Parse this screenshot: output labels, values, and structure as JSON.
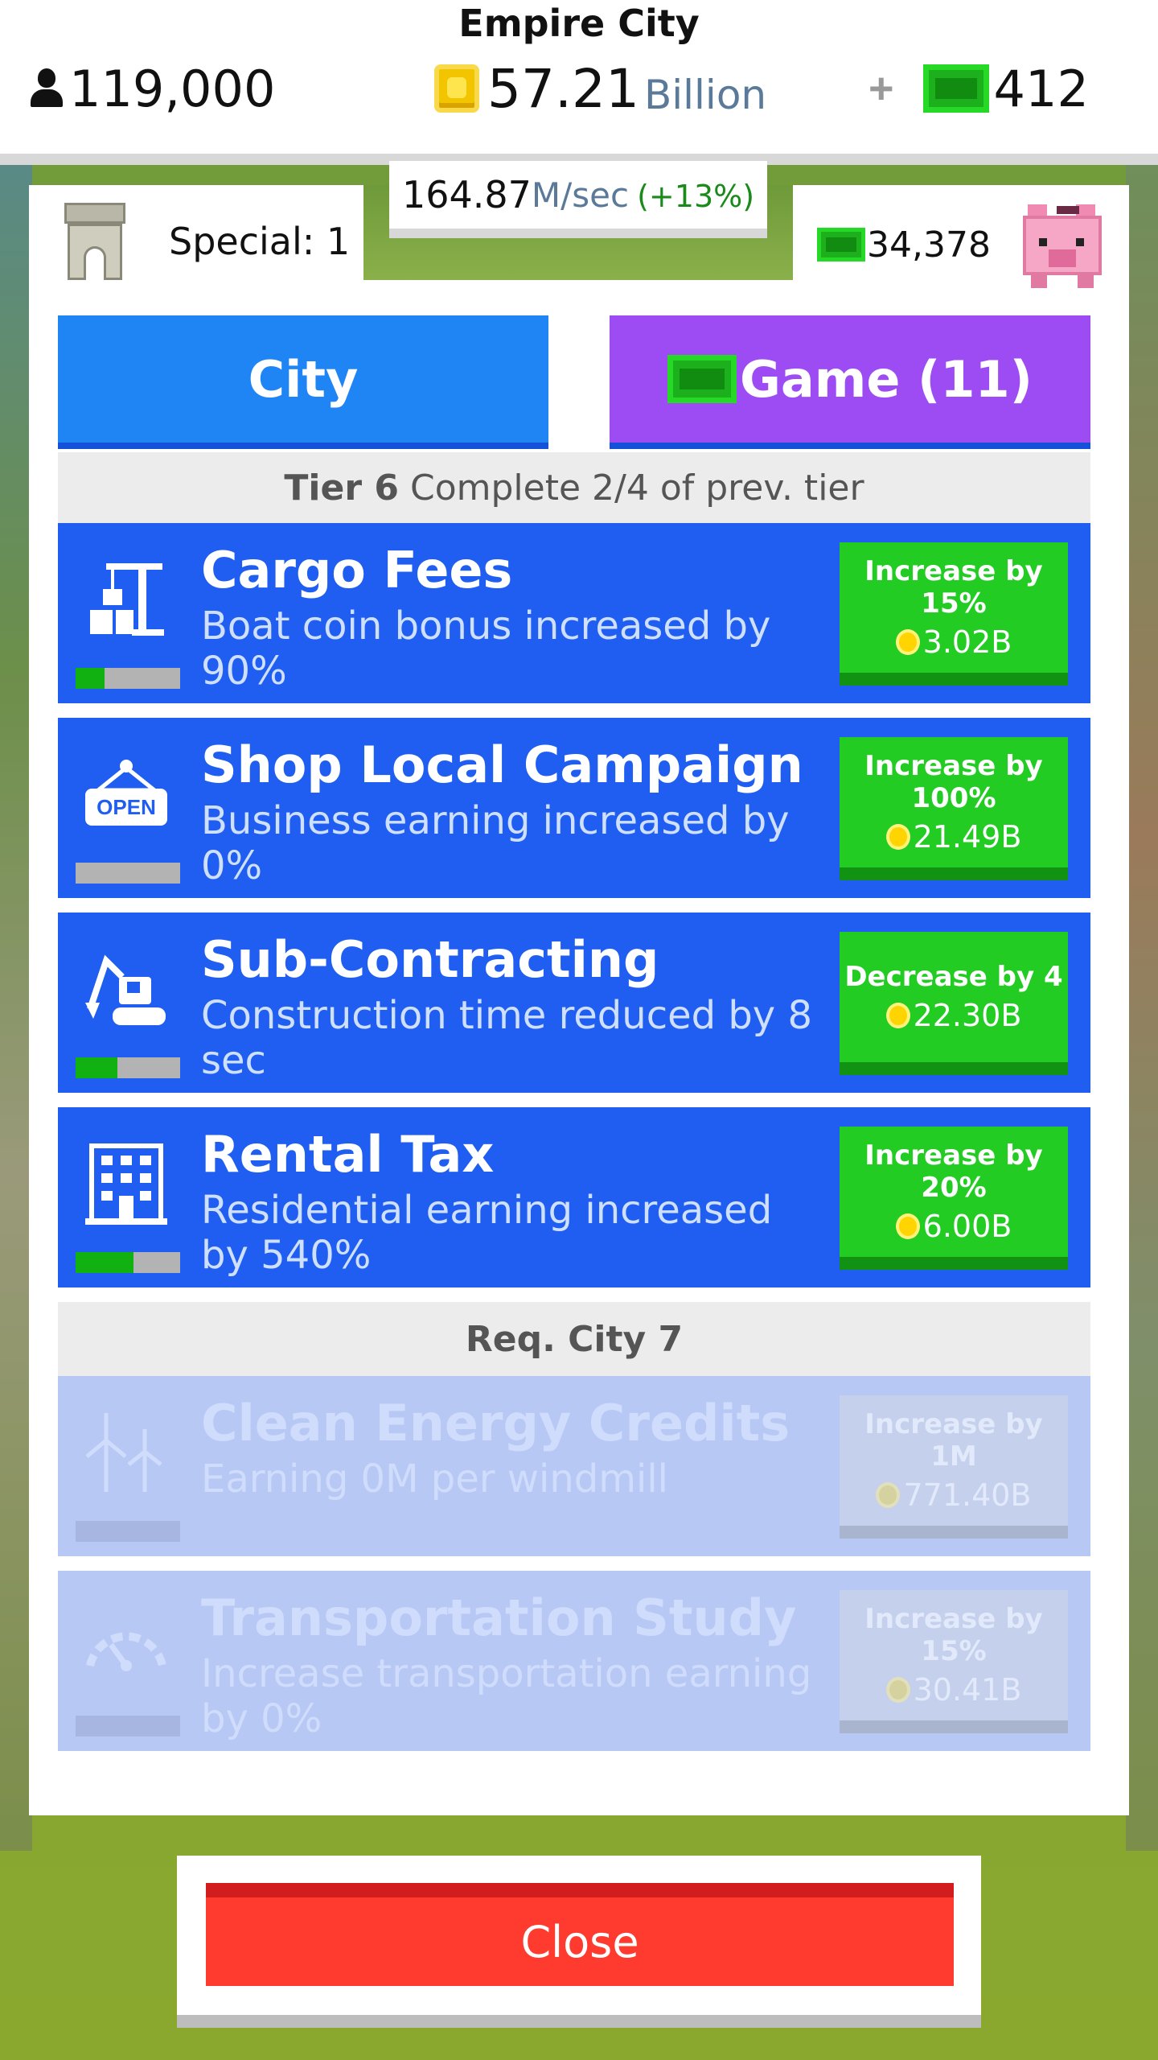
{
  "hud": {
    "title": "Empire City",
    "population": "119,000",
    "coins_value": "57.21",
    "coins_unit": "Billion",
    "plus": "+",
    "cash": "412"
  },
  "rate": {
    "value": "164.87",
    "unit": "M/sec",
    "bonus": "(+13%)"
  },
  "special": {
    "label": "Special: 1"
  },
  "bank": {
    "value": "34,378"
  },
  "tabs": [
    {
      "label": "City"
    },
    {
      "label": "Game (11)"
    }
  ],
  "tier": {
    "name": "Tier 6",
    "requirement": "Complete 2/4 of prev. tier"
  },
  "upgrades": [
    {
      "title": "Cargo Fees",
      "desc": "Boat coin bonus increased by 90%",
      "button": "Increase by 15%",
      "price": "3.02B",
      "progress": 0.28,
      "icon": "crane-icon"
    },
    {
      "title": "Shop Local Campaign",
      "desc": "Business earning increased by 0%",
      "button": "Increase by 100%",
      "price": "21.49B",
      "progress": 0.0,
      "icon": "open-sign-icon"
    },
    {
      "title": "Sub-Contracting",
      "desc": "Construction time reduced by 8 sec",
      "button": "Decrease by 4",
      "price": "22.30B",
      "progress": 0.4,
      "icon": "excavator-icon"
    },
    {
      "title": "Rental Tax",
      "desc": "Residential earning increased by 540%",
      "button": "Increase by 20%",
      "price": "6.00B",
      "progress": 0.55,
      "icon": "apartment-icon"
    }
  ],
  "locked_section": {
    "label": "Req. City 7"
  },
  "locked_upgrades": [
    {
      "title": "Clean Energy Credits",
      "desc": "Earning 0M per windmill",
      "button": "Increase by 1M",
      "price": "771.40B",
      "icon": "windmill-icon"
    },
    {
      "title": "Transportation Study",
      "desc": "Increase transportation earning by 0%",
      "button": "Increase by 15%",
      "price": "30.41B",
      "icon": "speedometer-icon"
    }
  ],
  "close": {
    "label": "Close"
  },
  "colors": {
    "tab_city": "#1f85f5",
    "tab_game": "#9d4cf4",
    "row_blue": "#1f5ef0",
    "buy_green": "#22cc22",
    "close_red": "#ff3b2f"
  }
}
